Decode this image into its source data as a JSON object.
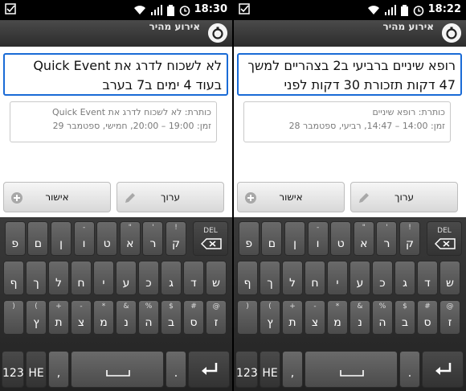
{
  "screens": [
    {
      "status": {
        "time": "18:30"
      },
      "app": {
        "title": "אירוע מהיר"
      },
      "input": {
        "value": "לא לשכוח לדרג את Quick Event בעוד 4 ימים ב7 בערב"
      },
      "preview": {
        "line1": "כותרת: לא לשכוח לדרג את Quick Event",
        "line2": "זמן: 19:00 – 20:00, חמישי, ספטמבר 29"
      },
      "buttons": {
        "edit": "ערוך",
        "confirm": "אישור"
      }
    },
    {
      "status": {
        "time": "18:22"
      },
      "app": {
        "title": "אירוע מהיר"
      },
      "input": {
        "value": "רופא שיניים ברביעי ב2 בצהריים למשך 47 דקות תזכורת 30 דקות לפני"
      },
      "preview": {
        "line1": "כותרת: רופא שיניים",
        "line2": "זמן: 14:00 – 14:47, רביעי, ספטמבר 28"
      },
      "buttons": {
        "edit": "ערוך",
        "confirm": "אישור"
      }
    }
  ],
  "keyboard": {
    "row1": [
      {
        "sup": "!",
        "main": "ק"
      },
      {
        "sup": "'",
        "main": "ר"
      },
      {
        "sup": "\"",
        "main": "א"
      },
      {
        "sup": "",
        "main": "ט"
      },
      {
        "sup": "-",
        "main": "ו"
      },
      {
        "sup": "",
        "main": "ן"
      },
      {
        "sup": "",
        "main": "ם"
      },
      {
        "sup": "",
        "main": "פ"
      }
    ],
    "row2": [
      "ש",
      "ד",
      "ג",
      "כ",
      "ע",
      "י",
      "ח",
      "ל",
      "ך",
      "ף"
    ],
    "row3": [
      {
        "sup": "@",
        "main": "ז"
      },
      {
        "sup": "#",
        "main": "ס"
      },
      {
        "sup": "$",
        "main": "ב"
      },
      {
        "sup": "%",
        "main": "ה"
      },
      {
        "sup": "&",
        "main": "נ"
      },
      {
        "sup": "*",
        "main": "מ"
      },
      {
        "sup": "-",
        "main": "צ"
      },
      {
        "sup": "+",
        "main": "ת"
      },
      {
        "sup": "(",
        "main": "ץ"
      },
      {
        "sup": ")",
        "main": ""
      }
    ],
    "del_label": "DEL",
    "num_label": "123",
    "lang_label": "HE",
    "comma": ",",
    "period": "."
  }
}
